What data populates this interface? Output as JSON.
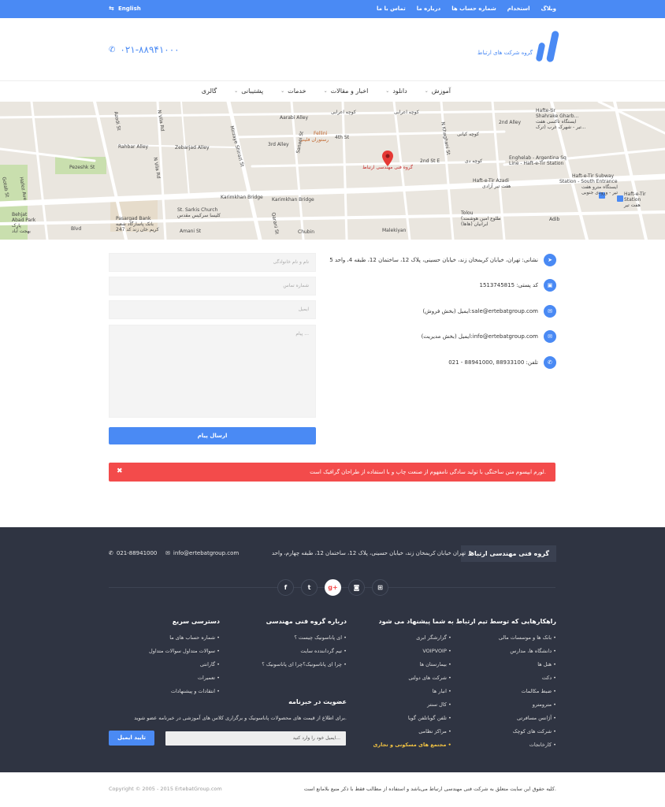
{
  "topbar": {
    "lang_label": "English",
    "links": [
      "وبلاگ",
      "استخدام",
      "شماره حساب ها",
      "درباره ما",
      "تماس با ما"
    ]
  },
  "header": {
    "logo_text": "گروه شرکت های ارتباط",
    "phone": "۰۲۱-۸۸۹۴۱۰۰۰"
  },
  "nav": {
    "items": [
      "آموزش",
      "دانلود",
      "اخبار و مقالات",
      "خدمات",
      "پشتیبانی",
      "گالری"
    ]
  },
  "map": {
    "labels": {
      "kooche_aarabi": "کوچه اعرابی",
      "aarabi_alley": "Aarabi Alley",
      "kooche_kiani": "کوچه کیانی",
      "kooche_dey": "کوچه دی",
      "fourth_st": "4th St",
      "third_alley": "3rd Alley",
      "second_st": "2nd St E",
      "second_alley": "2nd Alley",
      "rahbar_alley": "Rahbar Alley",
      "zebarjad_alley": "Zebarjad Alley",
      "pezeshk_st": "Pezeshk St",
      "karimkhan_bridge": "Karimkhan Bridge",
      "karimkhan_bridge2": "Karimkhan Bridge",
      "chubin": "Chubin",
      "malekiyan": "Malekiyan",
      "amani_st": "Amani St",
      "adib": "Adib",
      "fellini": "Fellini",
      "fellini_fa": "رستوران فلینی",
      "marker_label": "گروه فنی مهندسی ارتباط",
      "sarkis": "St. Sarkis Church",
      "sarkis_fa": "کلیسا سرکیس مقدس",
      "pasargad": "Pasargad Bank",
      "pasargad_fa": "بانک پاسارگاد شعبه",
      "pasargad_fa2": "کریم خان زند کد 247",
      "engelab": "Enghelab - Argentina Sq",
      "engelab2": "Line - Haft-e-Tir Station",
      "haft_tir_azadi": "Haft-e-Tir Azadi",
      "haft_tir_azadi_fa": "هفت تیر آزادی",
      "haft_tir_sub": "Haft-e-Tir Subway",
      "haft_tir_sub2": "Station - South Entrance",
      "haft_tir_sub_fa": "ایستگاه مترو هفت",
      "haft_tir_sub_fa2": "تیر - ورودی جنوبی",
      "haft_tir_station": "Haft-e-Tir",
      "haft_tir_station2": "Station",
      "haft_tir_fa": "هفت تیر",
      "tolou": "Tolou",
      "tolou2": "(طلوع امین هوشمند",
      "tolou3": "ابرانیان (هاها)",
      "behjat": "Behjat",
      "behjat2": "Abad Park",
      "behjat_fa": "پارک",
      "behjat_fa2": "بهجت آباد",
      "hafez": "Hafez Ave",
      "azodi": "Azodi St",
      "nvila": "N Vila Rd",
      "mirzaye": "Mirzaye Shirazi St",
      "sanaei": "Sanaei St",
      "qarani": "Qarani St",
      "kheradmand": "N Khaghani St",
      "gotab": "Gotab St",
      "haft_tir_top": "Hafte-tir",
      "haft_tir_top2": "Shahrake Gharb...",
      "haft_tir_top_fa": "ایستگاه تاکسی هفت",
      "haft_tir_top_fa2": "تیر - شهرک غرب (ترک...",
      "blvd": "Blvd"
    }
  },
  "contact": {
    "address": "نشانی: تهران، خیابان کریمخان زند، خیابان حسینی، پلاک 12، ساختمان 12، طبقه 4، واحد 5",
    "postal": "کد پستی: 1513745815",
    "email_sales": "ایمیل (بخش فروش):sale@ertebatgroup.com",
    "email_admin": "ایمیل (بخش مدیریت):info@ertebatgroup.com",
    "phone": "تلفن: 88933100 ,88941000 - 021"
  },
  "form": {
    "name_placeholder": "نام و نام خانوادگی",
    "phone_placeholder": "شماره تماس",
    "email_placeholder": "ایمیل",
    "message_placeholder": "پیام ...",
    "send_label": "ارسال پیام"
  },
  "alert": {
    "message": "لورم ایپسوم متن ساختگی با تولید سادگی نامفهوم از صنعت چاپ و با استفاده از طراحان گرافیک است.",
    "close": "✖"
  },
  "footer": {
    "brand": "گروه فنی مهندسی ارتباط",
    "address": "تهران خیابان کریمخان زند، خیابان حسینی، پلاک 12، ساختمان 12، طبقه چهارم، واحد",
    "email": "info@ertebatgroup.com",
    "phone": "021-88941000",
    "solutions_title": "راهکارهایی که توسط تیم ارتباط به شما پیشنهاد می شود",
    "solutions_a": [
      "بانک ها و موسسات مالی",
      "دانشگاه ها، مدارس",
      "هتل ها",
      "دکت",
      "ضبط مکالمات",
      "مترومترو",
      "آژانس مسافرتی",
      "شرکت های کوچک",
      "کارخانجات"
    ],
    "solutions_b": [
      "گزارشگر ابری",
      "VOIPVOIP",
      "بیمارستان ها",
      "شرکت های دولتی",
      "انبار ها",
      "کال سنتر",
      "تلفن گوباتلفن گویا",
      "مراکز نظامی",
      "مجتمع های مسکونی و تجاری"
    ],
    "about_title": "درباره گروه فنی مهندسی",
    "about_items": [
      "ای پاناسونیک چیست ؟",
      "تیم گردانندده سایت",
      "چرا ای پاناسونیک؟چرا ای پاناسونیک ؟"
    ],
    "quick_title": "دسترسی سریع",
    "quick_items": [
      "شماره حساب های ما",
      "سوالات متداول سوالات متداول",
      "گارانتی",
      "تعمیرات",
      "انتقادات و پیشنهادات"
    ],
    "newsletter_title": "عضویت در خبرنامه",
    "newsletter_text": "برای اطلاع از قیمت های محصولات پاناسونیک و برگزاری کلاس های آموزشی در خبرنامه عضو شوید.",
    "newsletter_placeholder": "ایمیل خود را وارد کنید...",
    "newsletter_button": "تایید ایمیل",
    "copyright_right": "کلیه حقوق این سایت متعلق به شرکت فنی مهندسی ارتباط می‌باشد و استفاده از مطالب فقط با ذکر منبع بلامانع است.",
    "copyright_left": "Copyright © 2005 - 2015 ErtebatGroup.com"
  }
}
